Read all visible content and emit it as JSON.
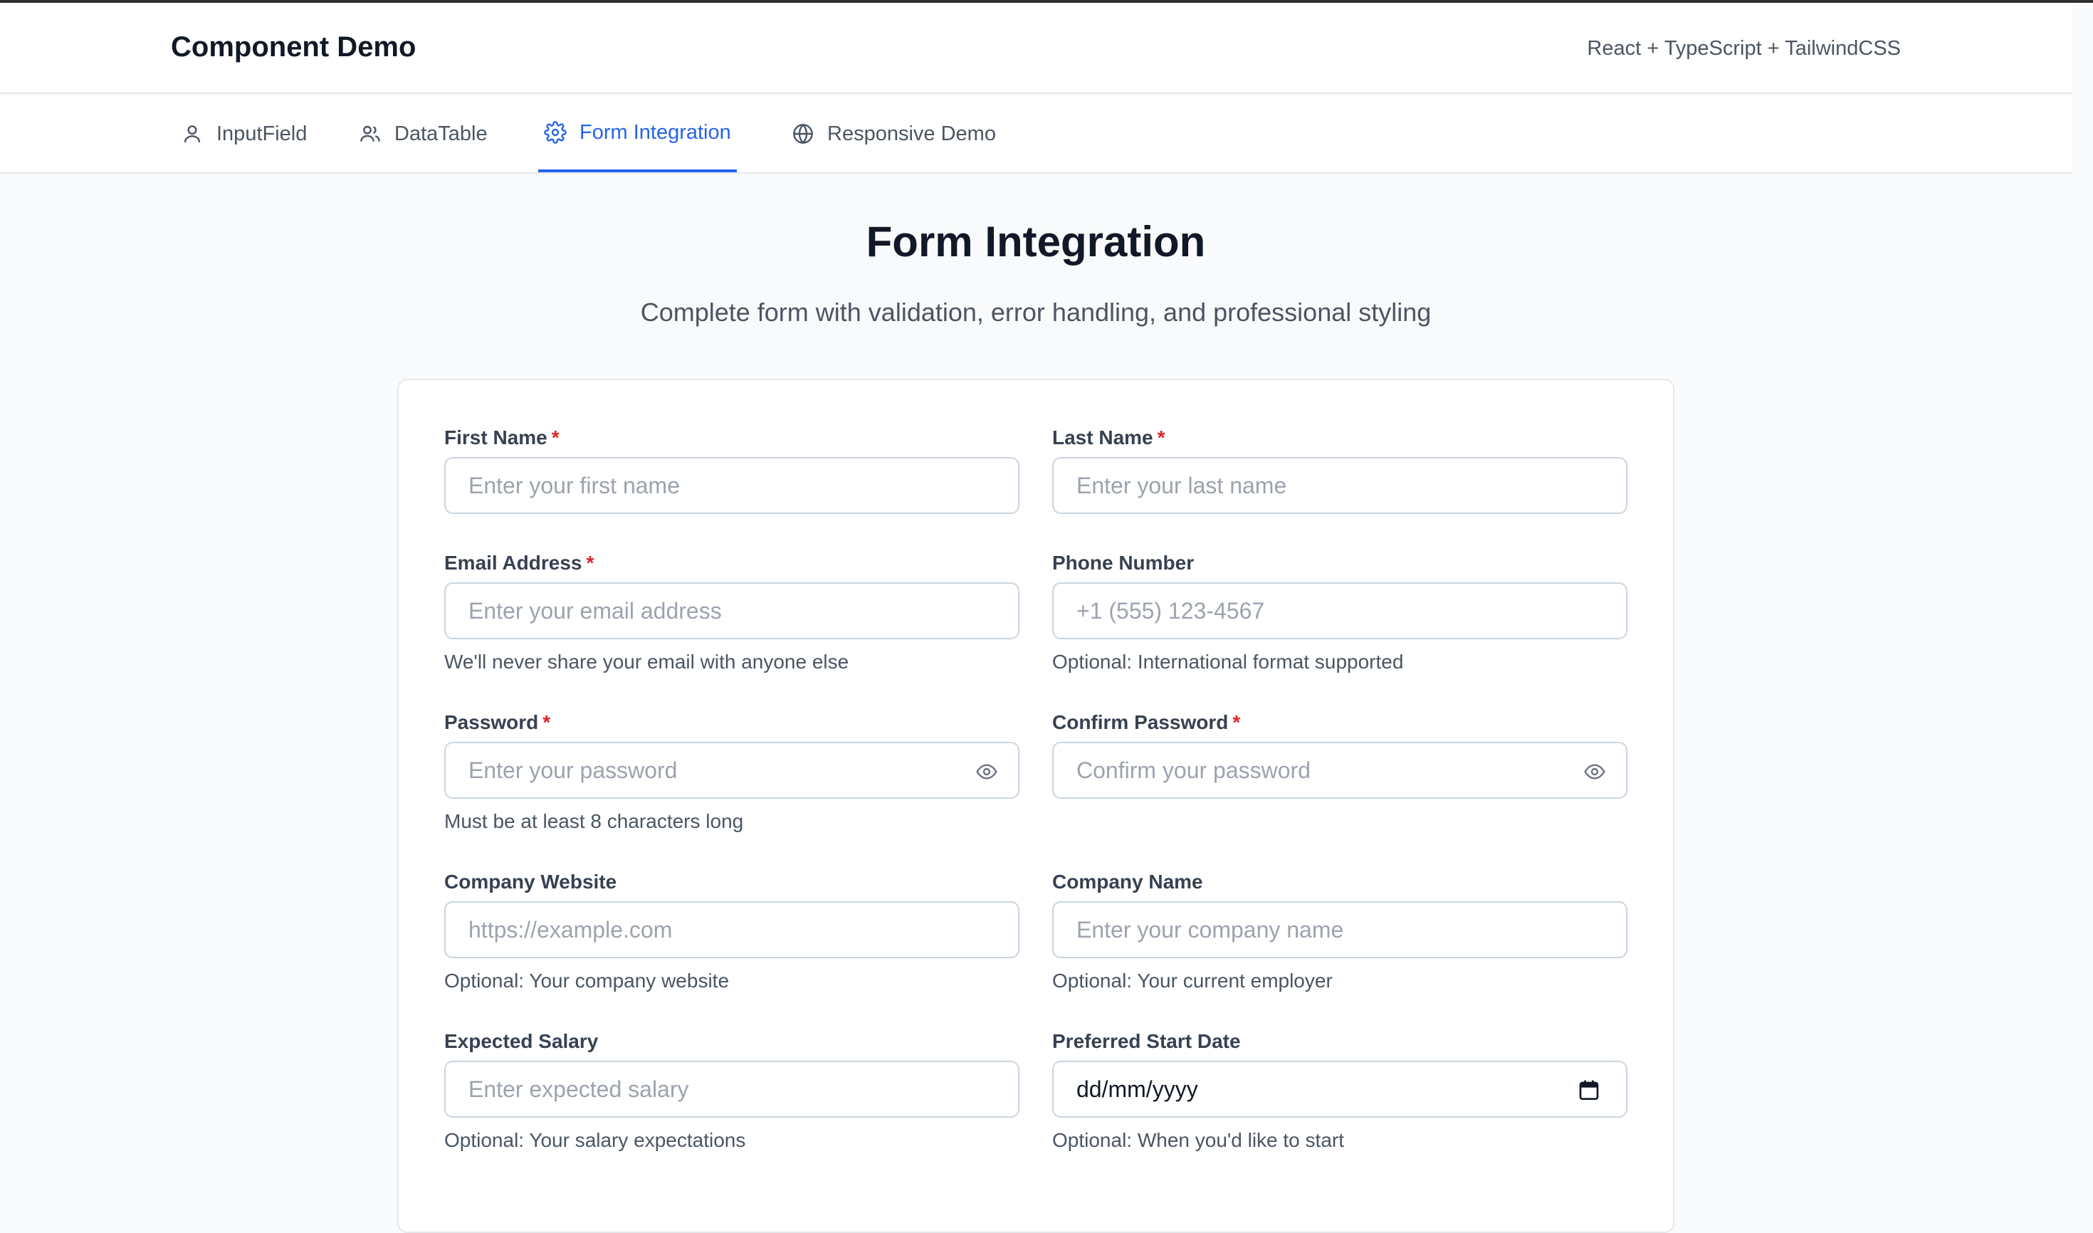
{
  "header": {
    "brand": "Component Demo",
    "stack": "React + TypeScript + TailwindCSS"
  },
  "tabs": [
    {
      "label": "InputField",
      "icon": "user-icon",
      "active": false
    },
    {
      "label": "DataTable",
      "icon": "users-icon",
      "active": false
    },
    {
      "label": "Form Integration",
      "icon": "gear-icon",
      "active": true
    },
    {
      "label": "Responsive Demo",
      "icon": "globe-icon",
      "active": false
    }
  ],
  "page": {
    "title": "Form Integration",
    "subtitle": "Complete form with validation, error handling, and professional styling"
  },
  "form": {
    "first_name": {
      "label": "First Name",
      "required": true,
      "placeholder": "Enter your first name"
    },
    "last_name": {
      "label": "Last Name",
      "required": true,
      "placeholder": "Enter your last name"
    },
    "email": {
      "label": "Email Address",
      "required": true,
      "placeholder": "Enter your email address",
      "helper": "We'll never share your email with anyone else"
    },
    "phone": {
      "label": "Phone Number",
      "required": false,
      "placeholder": "+1 (555) 123-4567",
      "helper": "Optional: International format supported"
    },
    "password": {
      "label": "Password",
      "required": true,
      "placeholder": "Enter your password",
      "helper": "Must be at least 8 characters long"
    },
    "confirm_password": {
      "label": "Confirm Password",
      "required": true,
      "placeholder": "Confirm your password"
    },
    "website": {
      "label": "Company Website",
      "required": false,
      "placeholder": "https://example.com",
      "helper": "Optional: Your company website"
    },
    "company": {
      "label": "Company Name",
      "required": false,
      "placeholder": "Enter your company name",
      "helper": "Optional: Your current employer"
    },
    "salary": {
      "label": "Expected Salary",
      "required": false,
      "placeholder": "Enter expected salary",
      "helper": "Optional: Your salary expectations"
    },
    "start_date": {
      "label": "Preferred Start Date",
      "required": false,
      "value": "dd/mm/yyyy",
      "helper": "Optional: When you'd like to start"
    }
  },
  "required_mark": "*",
  "colors": {
    "accent": "#2563eb",
    "required": "#dc2626",
    "border": "#cbd5e1"
  }
}
